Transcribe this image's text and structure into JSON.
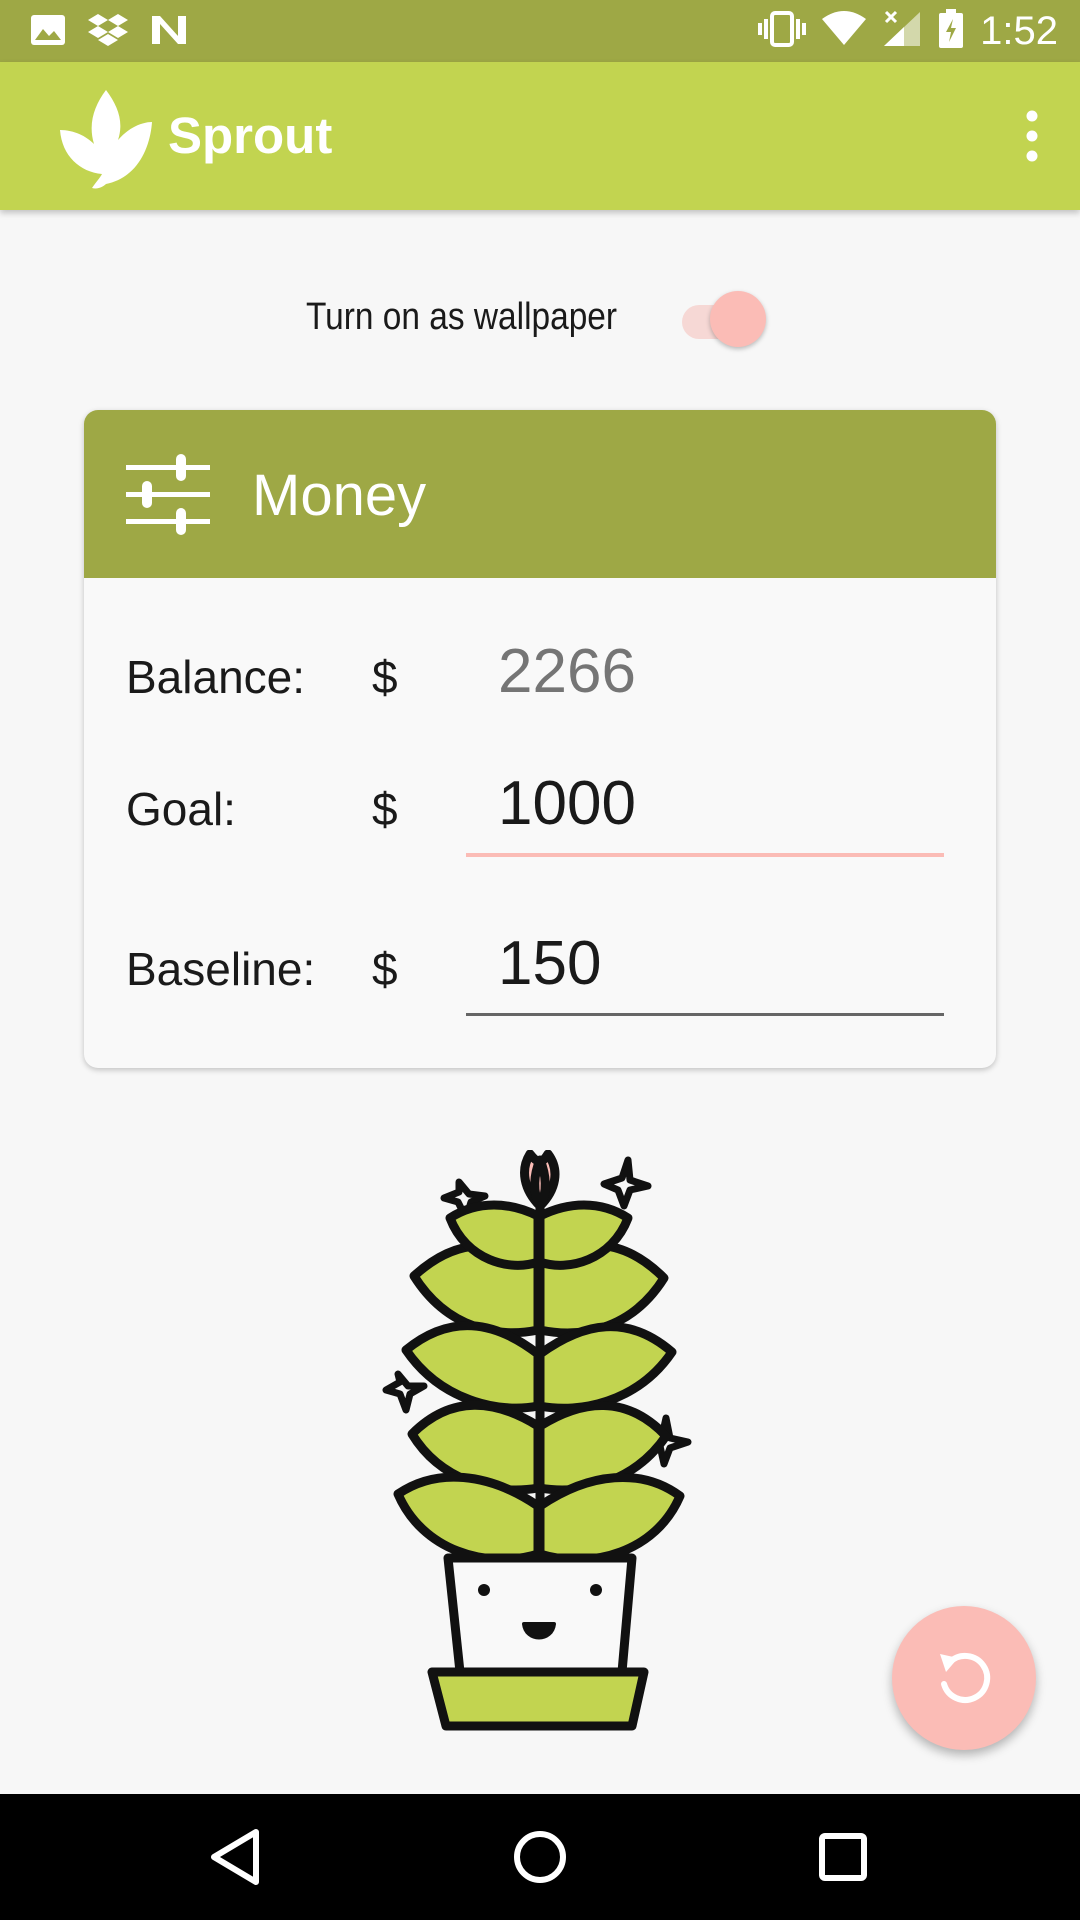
{
  "status_bar": {
    "time": "1:52",
    "icons_left": [
      "image-icon",
      "dropbox-icon",
      "n-icon"
    ],
    "icons_right": [
      "vibrate-icon",
      "wifi-icon",
      "signal-icon",
      "battery-icon"
    ]
  },
  "app_bar": {
    "title": "Sprout",
    "logo": "sprout-leaf-icon",
    "menu_icon": "more-vert-icon",
    "color": "#c2d450"
  },
  "wallpaper": {
    "label": "Turn on as wallpaper",
    "enabled": true,
    "accent": "#fbbcb6"
  },
  "money_card": {
    "title": "Money",
    "header_icon": "tune-icon",
    "header_color": "#9ea845",
    "balance": {
      "label": "Balance:",
      "currency": "$",
      "value": "2266"
    },
    "goal": {
      "label": "Goal:",
      "currency": "$",
      "value": "1000"
    },
    "baseline": {
      "label": "Baseline:",
      "currency": "$",
      "value": "150"
    }
  },
  "fab": {
    "icon": "refresh-icon",
    "color": "#fbbcb6"
  },
  "nav_bar": {
    "buttons": [
      "back-icon",
      "home-icon",
      "recents-icon"
    ]
  }
}
